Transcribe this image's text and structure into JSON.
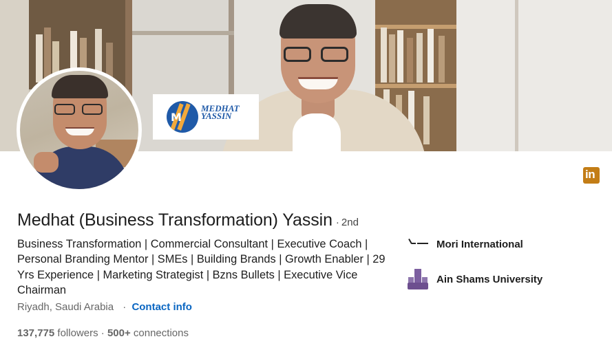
{
  "profile": {
    "name": "Medhat (Business Transformation) Yassin",
    "degree_sep": "·",
    "degree": "2nd",
    "headline": "Business Transformation | Commercial Consultant | Executive Coach | Personal Branding Mentor | SMEs | Building Brands | Growth Enabler | 29 Yrs Experience | Marketing Strategist | Bzns Bullets | Executive Vice Chairman",
    "location": "Riyadh, Saudi Arabia",
    "location_sep": "·",
    "contact_label": "Contact info",
    "followers_count": "137,775",
    "followers_label": "followers",
    "stats_sep": "·",
    "connections_count": "500+",
    "connections_label": "connections"
  },
  "banner": {
    "logo_line1": "MEDHAT",
    "logo_line2": "YASSIN"
  },
  "organizations": [
    {
      "name": "Mori International",
      "icon": "mori-logo-icon"
    },
    {
      "name": "Ain Shams University",
      "icon": "university-logo-icon"
    }
  ],
  "icons": {
    "network": "linkedin-icon",
    "network_glyph": "in"
  },
  "colors": {
    "link": "#0a66c2",
    "linkedin_badge": "#c37d16",
    "text_primary": "#1d1d1d",
    "text_secondary": "#666666"
  }
}
